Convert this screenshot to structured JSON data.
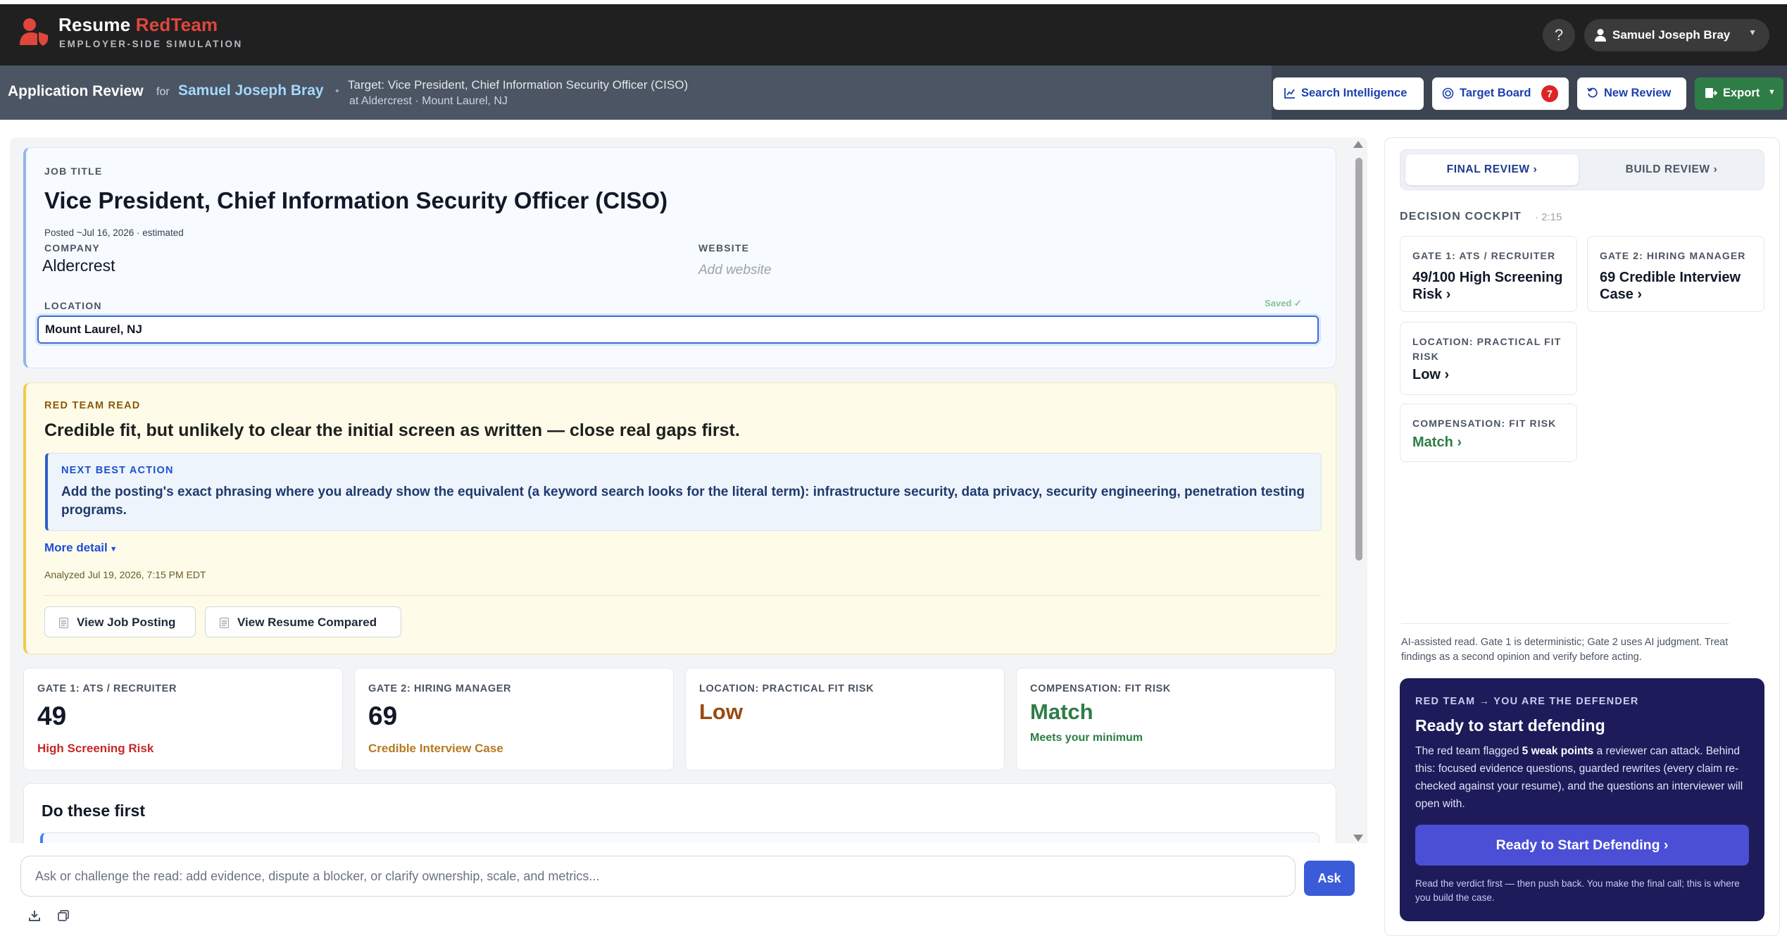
{
  "brand": {
    "name_part1": "Resume",
    "name_part2": "RedTeam",
    "subtitle": "EMPLOYER-SIDE SIMULATION"
  },
  "topbar": {
    "help_label": "?",
    "user_name": "Samuel Joseph Bray"
  },
  "header": {
    "title": "Application Review",
    "for_label": "for",
    "candidate": "Samuel Joseph Bray",
    "separator": "•",
    "target": "Target: Vice President, Chief Information Security Officer (CISO)",
    "target_location": "at Aldercrest · Mount Laurel, NJ",
    "buttons": {
      "search_intel": "Search Intelligence",
      "target_board": "Target Board",
      "target_board_count": "7",
      "new_review": "New Review",
      "export": "Export"
    }
  },
  "job": {
    "title_label": "JOB TITLE",
    "title": "Vice President, Chief Information Security Officer (CISO)",
    "posted": "Posted ~Jul 16, 2026 · estimated",
    "company_label": "COMPANY",
    "company": "Aldercrest",
    "website_label": "WEBSITE",
    "website_placeholder": "Add website",
    "location_label": "LOCATION",
    "location": "Mount Laurel, NJ",
    "saved": "Saved ✓"
  },
  "red_team": {
    "label": "RED TEAM READ",
    "headline": "Credible fit, but unlikely to clear the initial screen as written — close real gaps first.",
    "next_action_label": "NEXT BEST ACTION",
    "next_action": "Add the posting's exact phrasing where you already show the equivalent (a keyword search looks for the literal term): infrastructure security, data privacy, security engineering, penetration testing programs.",
    "more_detail": "More detail",
    "analyzed": "Analyzed Jul 19, 2026, 7:15 PM EDT",
    "view_posting": "View Job Posting",
    "view_resume": "View Resume Compared"
  },
  "stats": {
    "gate1": {
      "label": "GATE 1: ATS / RECRUITER",
      "value": "49",
      "sub": "High Screening Risk",
      "color": "#c62828"
    },
    "gate2": {
      "label": "GATE 2: HIRING MANAGER",
      "value": "69",
      "sub": "Credible Interview Case",
      "color": "#b7791f"
    },
    "location": {
      "label": "LOCATION: PRACTICAL FIT RISK",
      "value": "Low",
      "color": "#9a4a12"
    },
    "comp": {
      "label": "COMPENSATION: FIT RISK",
      "value": "Match",
      "sub": "Meets your minimum",
      "color": "#2e7d46"
    }
  },
  "do_these_first": {
    "title": "Do these first"
  },
  "chat": {
    "placeholder": "Ask or challenge the read: add evidence, dispute a blocker, or clarify ownership, scale, and metrics...",
    "ask": "Ask"
  },
  "right_panel": {
    "tab_final": "FINAL REVIEW ›",
    "tab_build": "BUILD REVIEW ›",
    "cockpit_label": "DECISION COCKPIT",
    "cockpit_time": "· 2:15",
    "gate1": {
      "label": "GATE 1: ATS / RECRUITER",
      "value": "49/100 High Screening Risk ›"
    },
    "gate2": {
      "label": "GATE 2: HIRING MANAGER",
      "value": "69 Credible Interview Case ›"
    },
    "location": {
      "label": "LOCATION: PRACTICAL FIT RISK",
      "value": "Low ›"
    },
    "comp": {
      "label": "COMPENSATION: FIT RISK",
      "value": "Match ›"
    },
    "disclaimer": "AI-assisted read. Gate 1 is deterministic; Gate 2 uses AI judgment. Treat findings as a second opinion and verify before acting.",
    "defender": {
      "label": "RED TEAM → YOU ARE THE DEFENDER",
      "title": "Ready to start defending",
      "body_pre": "The red team flagged",
      "body_bold": "5 weak points",
      "body_post": "a reviewer can attack. Behind this: focused evidence questions, guarded rewrites (every claim re-checked against your resume), and the questions an interviewer will open with.",
      "cta": "Ready to Start Defending ›",
      "foot": "Read the verdict first — then push back. You make the final call; this is where you build the case."
    }
  },
  "icons": [
    "user-shield-logo-icon",
    "help-icon",
    "user-icon",
    "chart-icon",
    "target-icon",
    "refresh-icon",
    "export-icon",
    "document-icon",
    "download-icon",
    "copy-icon"
  ]
}
